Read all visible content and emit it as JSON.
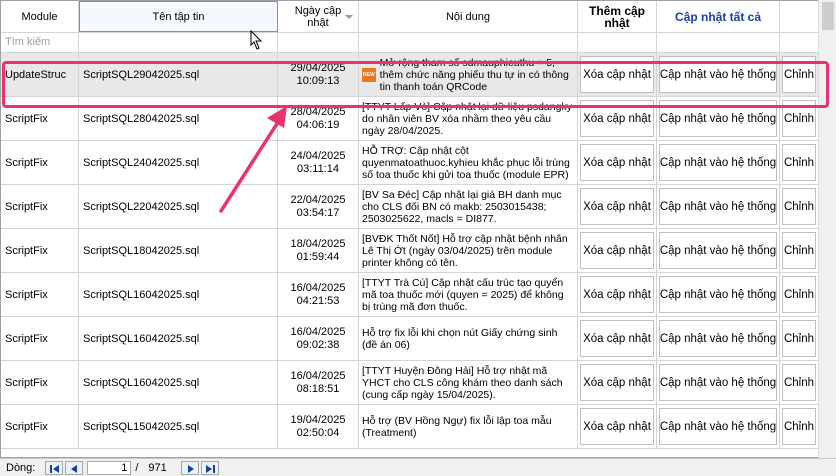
{
  "header": {
    "module": "Module",
    "filename": "Tên tập tin",
    "date": "Ngày cập nhật",
    "content": "Nội dung",
    "add_update": "Thêm cập nhật",
    "update_all": "Cập nhật tất cả"
  },
  "filter": {
    "placeholder": "Tìm kiếm"
  },
  "rows": [
    {
      "module": "UpdateStruc",
      "file": "ScriptSQL29042025.sql",
      "date": "29/04/2025",
      "time": "10:09:13",
      "content": "Mở rộng tham số sdmauphieuthu = 5, thêm chức năng phiếu thu tự in có thông tin thanh toán QRCode",
      "is_new": true
    },
    {
      "module": "ScriptFix",
      "file": "ScriptSQL28042025.sql",
      "date": "28/04/2025",
      "time": "04:06:19",
      "content": "[TTYT Lấp Vò] Cập nhật lại dữ liệu psdangky do nhân viên BV xóa nhầm theo yêu cầu ngày 28/04/2025.",
      "is_new": false
    },
    {
      "module": "ScriptFix",
      "file": "ScriptSQL24042025.sql",
      "date": "24/04/2025",
      "time": "03:11:14",
      "content": "HỖ TRỢ: Cập nhật cột quyenmatoathuoc.kyhieu khắc phục lỗi trùng số toa thuốc khi gửi toa thuốc (module EPR)",
      "is_new": false
    },
    {
      "module": "ScriptFix",
      "file": "ScriptSQL22042025.sql",
      "date": "22/04/2025",
      "time": "03:54:17",
      "content": "[BV Sa Đéc] Cập nhật lại giá BH danh mục cho CLS đối BN có makb: 2503015438; 2503025622, macls = DI877.",
      "is_new": false
    },
    {
      "module": "ScriptFix",
      "file": "ScriptSQL18042025.sql",
      "date": "18/04/2025",
      "time": "01:59:44",
      "content": "[BVĐK Thốt Nốt] Hỗ trợ cập nhật bệnh nhân Lê Thị Ớt (ngày 03/04/2025) trên module printer không có tên.",
      "is_new": false
    },
    {
      "module": "ScriptFix",
      "file": "ScriptSQL16042025.sql",
      "date": "16/04/2025",
      "time": "04:21:53",
      "content": "[TTYT Trà Cú] Cập nhật cấu trúc tạo quyển mã toa thuốc mới (quyen = 2025) để không bị trùng mã đơn thuốc.",
      "is_new": false
    },
    {
      "module": "ScriptFix",
      "file": "ScriptSQL16042025.sql",
      "date": "16/04/2025",
      "time": "09:02:38",
      "content": "Hỗ trợ fix lỗi khi chọn nút Giấy chứng sinh (đề án 06)",
      "is_new": false
    },
    {
      "module": "ScriptFix",
      "file": "ScriptSQL16042025.sql",
      "date": "16/04/2025",
      "time": "08:18:51",
      "content": "[TTYT Huyện Đông Hải] Hỗ trợ nhật mã YHCT cho CLS công khám theo danh sách (cung cấp ngày 15/04/2025).",
      "is_new": false
    },
    {
      "module": "ScriptFix",
      "file": "ScriptSQL15042025.sql",
      "date": "19/04/2025",
      "time": "02:50:04",
      "content": "Hỗ trợ (BV Hồng Ngự) fix lỗi lập toa mẫu (Treatment)",
      "is_new": false
    }
  ],
  "buttons": {
    "remove": "Xóa cập nhật",
    "apply": "Cập nhật vào hệ thống",
    "edit": "Chỉnh"
  },
  "new_tag": "NEW",
  "footer": {
    "label": "Dòng:",
    "current": "1",
    "separator": "/",
    "total": "971"
  },
  "colors": {
    "highlight": "#e8336b",
    "header_blue": "#1a3fa6"
  }
}
